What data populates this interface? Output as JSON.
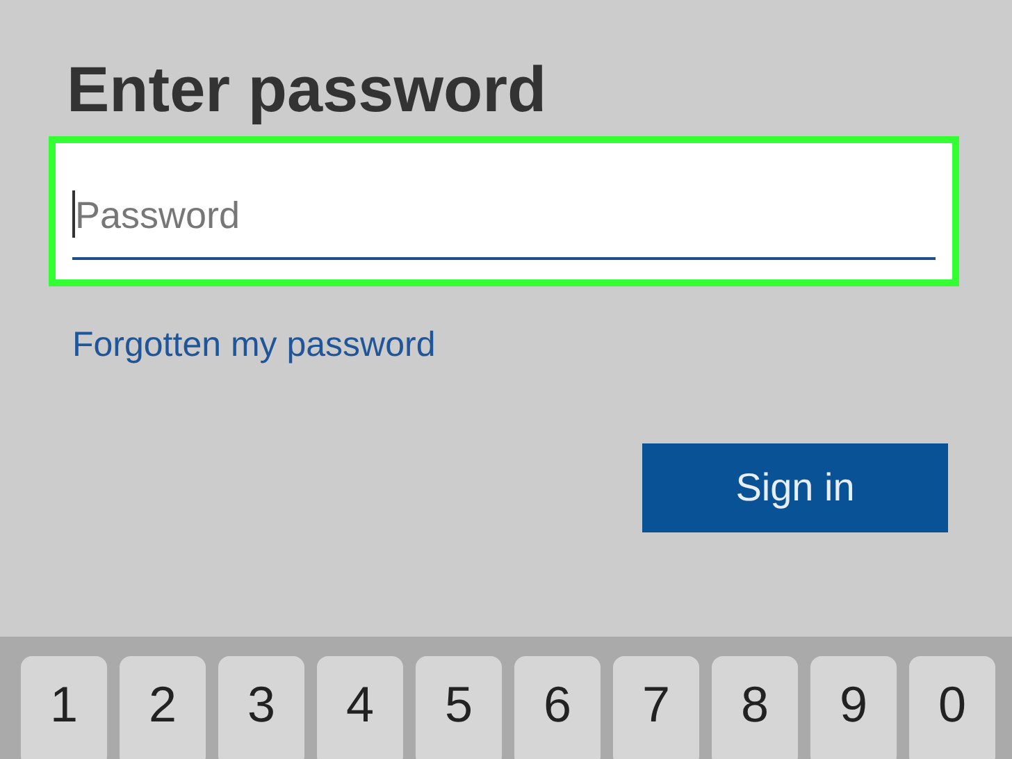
{
  "title": "Enter password",
  "password_field": {
    "placeholder": "Password",
    "highlighted": true,
    "focused": true
  },
  "forgot_link": "Forgotten my password",
  "sign_in_button": "Sign in",
  "keyboard": {
    "keys": [
      "1",
      "2",
      "3",
      "4",
      "5",
      "6",
      "7",
      "8",
      "9",
      "0"
    ]
  }
}
